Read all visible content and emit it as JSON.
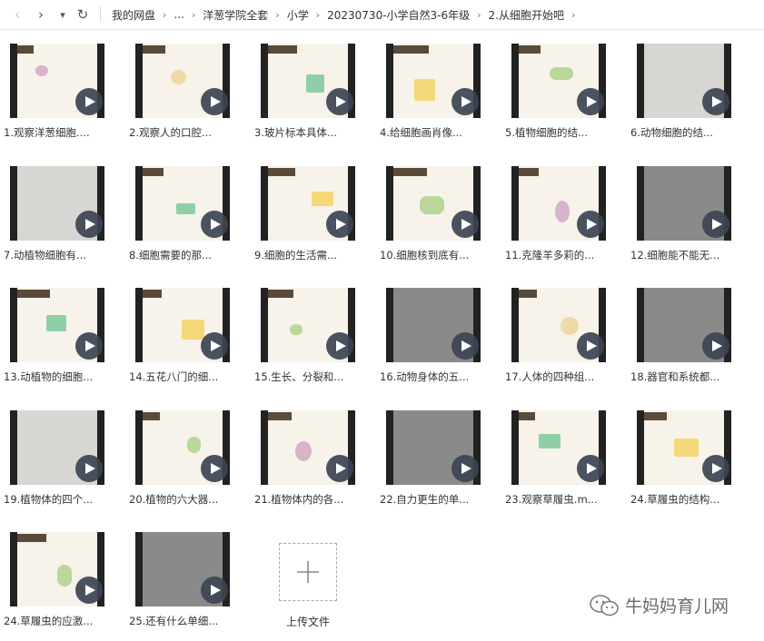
{
  "nav": {
    "back_glyph": "‹",
    "forward_glyph": "›",
    "dropdown_glyph": "▾",
    "refresh_glyph": "↻"
  },
  "breadcrumb": {
    "items": [
      "我的网盘",
      "...",
      "洋葱学院全套",
      "小学",
      "20230730-小学自然3-6年级",
      "2.从细胞开始吧"
    ],
    "separator": "›"
  },
  "files": [
    {
      "name": "1.观察洋葱细胞....",
      "style": "light"
    },
    {
      "name": "2.观察人的口腔...",
      "style": "light"
    },
    {
      "name": "3.玻片标本具体...",
      "style": "light"
    },
    {
      "name": "4.给细胞画肖像...",
      "style": "light"
    },
    {
      "name": "5.植物细胞的结...",
      "style": "light"
    },
    {
      "name": "6.动物细胞的结...",
      "style": "lightgray"
    },
    {
      "name": "7.动植物细胞有...",
      "style": "lightgray"
    },
    {
      "name": "8.细胞需要的那...",
      "style": "light"
    },
    {
      "name": "9.细胞的生活需...",
      "style": "light"
    },
    {
      "name": "10.细胞核到底有...",
      "style": "light"
    },
    {
      "name": "11.克隆羊多莉的...",
      "style": "light"
    },
    {
      "name": "12.细胞能不能无...",
      "style": "gray"
    },
    {
      "name": "13.动植物的细胞...",
      "style": "light"
    },
    {
      "name": "14.五花八门的细...",
      "style": "light"
    },
    {
      "name": "15.生长、分裂和...",
      "style": "light"
    },
    {
      "name": "16.动物身体的五...",
      "style": "gray"
    },
    {
      "name": "17.人体的四种组...",
      "style": "light"
    },
    {
      "name": "18.器官和系统都...",
      "style": "gray"
    },
    {
      "name": "19.植物体的四个...",
      "style": "lightgray"
    },
    {
      "name": "20.植物的六大器...",
      "style": "light"
    },
    {
      "name": "21.植物体内的各...",
      "style": "light"
    },
    {
      "name": "22.自力更生的单...",
      "style": "gray"
    },
    {
      "name": "23.观察草履虫.m...",
      "style": "light"
    },
    {
      "name": "24.草履虫的结构...",
      "style": "light"
    },
    {
      "name": "24.草履虫的应激...",
      "style": "light"
    },
    {
      "name": "25.还有什么单细...",
      "style": "gray"
    }
  ],
  "upload": {
    "label": "上传文件",
    "glyph": "+"
  },
  "watermark": {
    "text": "牛妈妈育儿网"
  },
  "colors": {
    "play_bg": "#3c4452",
    "thumb_bg": "#f7f2ea",
    "accent_tag": "#5a4a3a"
  }
}
